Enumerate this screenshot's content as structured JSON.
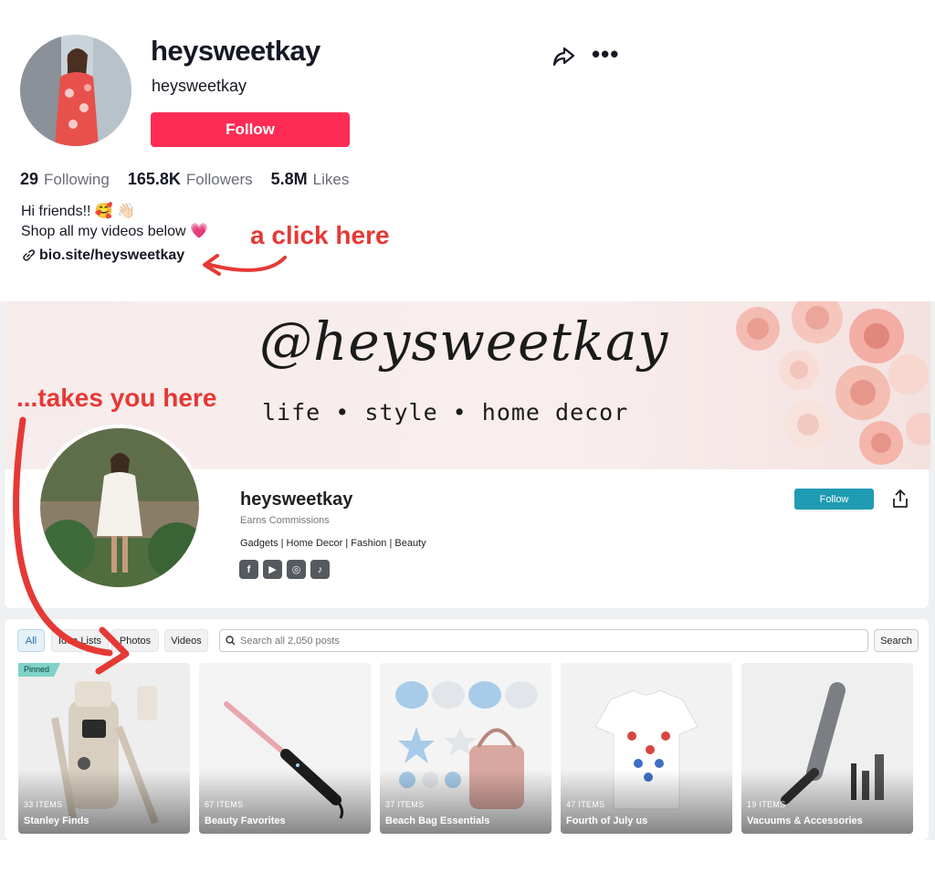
{
  "tiktok": {
    "display_name": "heysweetkay",
    "username": "heysweetkay",
    "follow_label": "Follow",
    "stats": [
      {
        "value": "29",
        "label": "Following"
      },
      {
        "value": "165.8K",
        "label": "Followers"
      },
      {
        "value": "5.8M",
        "label": "Likes"
      }
    ],
    "bio_line1": "Hi friends!! 🥰 👋🏻",
    "bio_line2": "Shop all my videos below 💗",
    "bio_link": "bio.site/heysweetkay"
  },
  "annotations": {
    "click_here": "a click here",
    "takes_you_here": "...takes you here",
    "color": "#e53935"
  },
  "bio_site": {
    "banner_script": "@heysweetkay",
    "banner_tagline": "life • style • home decor",
    "name": "heysweetkay",
    "earns": "Earns Commissions",
    "categories": "Gadgets | Home Decor | Fashion | Beauty",
    "follow_label": "Follow",
    "social_icons": [
      "facebook-icon",
      "youtube-icon",
      "instagram-icon",
      "tiktok-icon"
    ],
    "tabs": [
      "All",
      "Idea Lists",
      "Photos",
      "Videos"
    ],
    "search_placeholder": "Search all 2,050 posts",
    "search_button": "Search",
    "pinned_label": "Pinned",
    "collections": [
      {
        "count": "33 ITEMS",
        "title": "Stanley Finds"
      },
      {
        "count": "67 ITEMS",
        "title": "Beauty Favorites"
      },
      {
        "count": "37 ITEMS",
        "title": "Beach Bag Essentials"
      },
      {
        "count": "47 ITEMS",
        "title": "Fourth of July us"
      },
      {
        "count": "19 ITEMS",
        "title": "Vacuums & Accessories"
      }
    ]
  },
  "colors": {
    "tiktok_red": "#fe2c55",
    "store_teal": "#1f9bb3"
  }
}
